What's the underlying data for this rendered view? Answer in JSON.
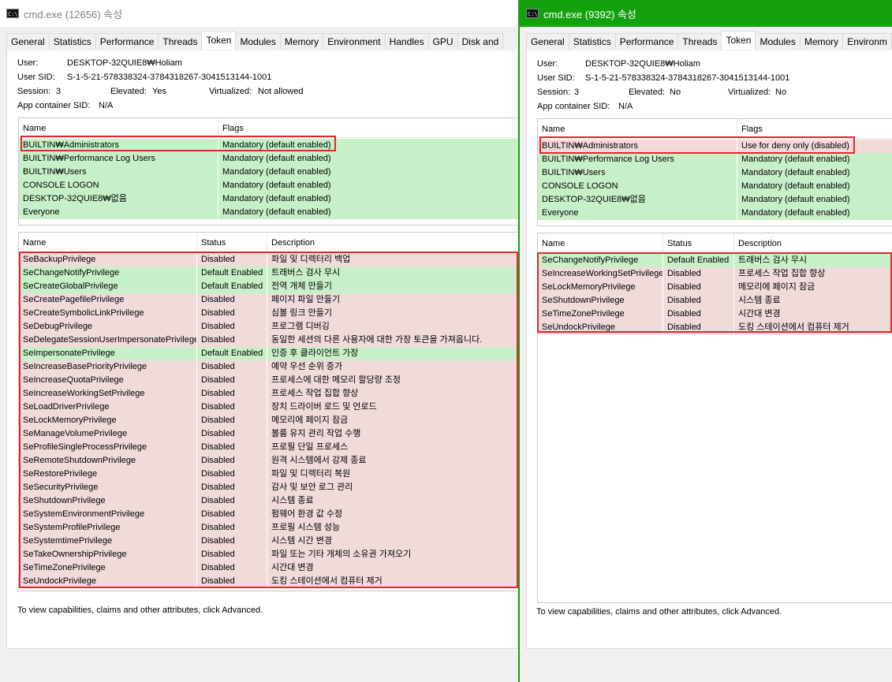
{
  "win1": {
    "title": "cmd.exe (12656) 속성",
    "tabs": [
      "General",
      "Statistics",
      "Performance",
      "Threads",
      "Token",
      "Modules",
      "Memory",
      "Environment",
      "Handles",
      "GPU",
      "Disk and"
    ],
    "active_tab": "Token",
    "user_label": "User:",
    "user": "DESKTOP-32QUIE8₩Holiam",
    "sid_label": "User SID:",
    "sid": "S-1-5-21-578338324-3784318267-3041513144-1001",
    "session_label": "Session:",
    "session": "3",
    "elevated_label": "Elevated:",
    "elevated": "Yes",
    "virtualized_label": "Virtualized:",
    "virtualized": "Not allowed",
    "appcontainer_label": "App container SID:",
    "appcontainer": "N/A",
    "groups_headers": [
      "Name",
      "Flags"
    ],
    "groups": [
      {
        "name": "BUILTIN₩Administrators",
        "flags": "Mandatory (default enabled)",
        "state": "green"
      },
      {
        "name": "BUILTIN₩Performance Log Users",
        "flags": "Mandatory (default enabled)",
        "state": "green"
      },
      {
        "name": "BUILTIN₩Users",
        "flags": "Mandatory (default enabled)",
        "state": "green"
      },
      {
        "name": "CONSOLE LOGON",
        "flags": "Mandatory (default enabled)",
        "state": "green"
      },
      {
        "name": "DESKTOP-32QUIE8₩없음",
        "flags": "Mandatory (default enabled)",
        "state": "green"
      },
      {
        "name": "Everyone",
        "flags": "Mandatory (default enabled)",
        "state": "green"
      }
    ],
    "priv_headers": [
      "Name",
      "Status",
      "Description"
    ],
    "privileges": [
      {
        "name": "SeBackupPrivilege",
        "status": "Disabled",
        "desc": "파일 및 디렉터리 백업",
        "state": "red"
      },
      {
        "name": "SeChangeNotifyPrivilege",
        "status": "Default Enabled",
        "desc": "트래버스 검사 무시",
        "state": "green"
      },
      {
        "name": "SeCreateGlobalPrivilege",
        "status": "Default Enabled",
        "desc": "전역 개체 만들기",
        "state": "green"
      },
      {
        "name": "SeCreatePagefilePrivilege",
        "status": "Disabled",
        "desc": "페이지 파일 만들기",
        "state": "red"
      },
      {
        "name": "SeCreateSymbolicLinkPrivilege",
        "status": "Disabled",
        "desc": "심볼 링크 만들기",
        "state": "red"
      },
      {
        "name": "SeDebugPrivilege",
        "status": "Disabled",
        "desc": "프로그램 디버깅",
        "state": "red"
      },
      {
        "name": "SeDelegateSessionUserImpersonatePrivilege",
        "status": "Disabled",
        "desc": "동일한 세션의 다른 사용자에 대한 가장 토큰을 가져옵니다.",
        "state": "red"
      },
      {
        "name": "SeImpersonatePrivilege",
        "status": "Default Enabled",
        "desc": "인증 후 클라이언트 가장",
        "state": "green"
      },
      {
        "name": "SeIncreaseBasePriorityPrivilege",
        "status": "Disabled",
        "desc": "예약 우선 순위 증가",
        "state": "red"
      },
      {
        "name": "SeIncreaseQuotaPrivilege",
        "status": "Disabled",
        "desc": "프로세스에 대한 메모리 할당량 조정",
        "state": "red"
      },
      {
        "name": "SeIncreaseWorkingSetPrivilege",
        "status": "Disabled",
        "desc": "프로세스 작업 집합 향상",
        "state": "red"
      },
      {
        "name": "SeLoadDriverPrivilege",
        "status": "Disabled",
        "desc": "장치 드라이버 로드 및 언로드",
        "state": "red"
      },
      {
        "name": "SeLockMemoryPrivilege",
        "status": "Disabled",
        "desc": "메모리에 페이지 잠금",
        "state": "red"
      },
      {
        "name": "SeManageVolumePrivilege",
        "status": "Disabled",
        "desc": "볼륨 유지 관리 작업 수행",
        "state": "red"
      },
      {
        "name": "SeProfileSingleProcessPrivilege",
        "status": "Disabled",
        "desc": "프로필 단일 프로세스",
        "state": "red"
      },
      {
        "name": "SeRemoteShutdownPrivilege",
        "status": "Disabled",
        "desc": "원격 시스템에서 강제 종료",
        "state": "red"
      },
      {
        "name": "SeRestorePrivilege",
        "status": "Disabled",
        "desc": "파일 및 디렉터리 복원",
        "state": "red"
      },
      {
        "name": "SeSecurityPrivilege",
        "status": "Disabled",
        "desc": "감사 및 보안 로그 관리",
        "state": "red"
      },
      {
        "name": "SeShutdownPrivilege",
        "status": "Disabled",
        "desc": "시스템 종료",
        "state": "red"
      },
      {
        "name": "SeSystemEnvironmentPrivilege",
        "status": "Disabled",
        "desc": "펌웨어 환경 값 수정",
        "state": "red"
      },
      {
        "name": "SeSystemProfilePrivilege",
        "status": "Disabled",
        "desc": "프로필 시스템 성능",
        "state": "red"
      },
      {
        "name": "SeSystemtimePrivilege",
        "status": "Disabled",
        "desc": "시스템 시간 변경",
        "state": "red"
      },
      {
        "name": "SeTakeOwnershipPrivilege",
        "status": "Disabled",
        "desc": "파일 또는 기타 개체의 소유권 가져오기",
        "state": "red"
      },
      {
        "name": "SeTimeZonePrivilege",
        "status": "Disabled",
        "desc": "시간대 변경",
        "state": "red"
      },
      {
        "name": "SeUndockPrivilege",
        "status": "Disabled",
        "desc": "도킹 스테이션에서 컴퓨터 제거",
        "state": "red"
      }
    ],
    "footer": "To view capabilities, claims and other attributes, click Advanced."
  },
  "win2": {
    "title": "cmd.exe (9392) 속성",
    "tabs": [
      "General",
      "Statistics",
      "Performance",
      "Threads",
      "Token",
      "Modules",
      "Memory",
      "Environm"
    ],
    "active_tab": "Token",
    "user_label": "User:",
    "user": "DESKTOP-32QUIE8₩Holiam",
    "sid_label": "User SID:",
    "sid": "S-1-5-21-578338324-3784318267-3041513144-1001",
    "session_label": "Session:",
    "session": "3",
    "elevated_label": "Elevated:",
    "elevated": "No",
    "virtualized_label": "Virtualized:",
    "virtualized": "No",
    "appcontainer_label": "App container SID:",
    "appcontainer": "N/A",
    "groups_headers": [
      "Name",
      "Flags"
    ],
    "groups": [
      {
        "name": "BUILTIN₩Administrators",
        "flags": "Use for deny only (disabled)",
        "state": "red"
      },
      {
        "name": "BUILTIN₩Performance Log Users",
        "flags": "Mandatory (default enabled)",
        "state": "green"
      },
      {
        "name": "BUILTIN₩Users",
        "flags": "Mandatory (default enabled)",
        "state": "green"
      },
      {
        "name": "CONSOLE LOGON",
        "flags": "Mandatory (default enabled)",
        "state": "green"
      },
      {
        "name": "DESKTOP-32QUIE8₩없음",
        "flags": "Mandatory (default enabled)",
        "state": "green"
      },
      {
        "name": "Everyone",
        "flags": "Mandatory (default enabled)",
        "state": "green"
      }
    ],
    "priv_headers": [
      "Name",
      "Status",
      "Description"
    ],
    "privileges": [
      {
        "name": "SeChangeNotifyPrivilege",
        "status": "Default Enabled",
        "desc": "트래버스 검사 무시",
        "state": "green"
      },
      {
        "name": "SeIncreaseWorkingSetPrivilege",
        "status": "Disabled",
        "desc": "프로세스 작업 집합 향상",
        "state": "red"
      },
      {
        "name": "SeLockMemoryPrivilege",
        "status": "Disabled",
        "desc": "메모리에 페이지 잠금",
        "state": "red"
      },
      {
        "name": "SeShutdownPrivilege",
        "status": "Disabled",
        "desc": "시스템 종료",
        "state": "red"
      },
      {
        "name": "SeTimeZonePrivilege",
        "status": "Disabled",
        "desc": "시간대 변경",
        "state": "red"
      },
      {
        "name": "SeUndockPrivilege",
        "status": "Disabled",
        "desc": "도킹 스테이션에서 컴퓨터 제거",
        "state": "red"
      }
    ],
    "footer": "To view capabilities, claims and other attributes, click Advanced."
  },
  "colors": {
    "red_row": "#f0dada",
    "green_row": "#c8f0c8",
    "highlight": "#e0282d",
    "active_title": "#13a10e"
  }
}
